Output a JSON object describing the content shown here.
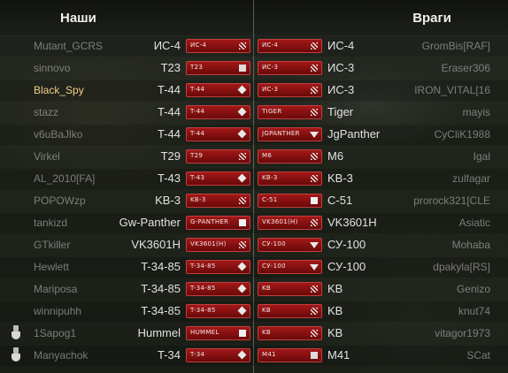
{
  "header": {
    "left_title": "Наши",
    "right_title": "Враги"
  },
  "colors": {
    "badge_red": "#8a1010",
    "highlight_player": "#f0d080"
  },
  "left_team": [
    {
      "player": "Mutant_GCRS",
      "tank": "ИС-4",
      "badge": "ИС-4",
      "icon": "heavy-tank-icon"
    },
    {
      "player": "sinnovo",
      "tank": "T23",
      "badge": "T23",
      "icon": "light-tank-icon"
    },
    {
      "player": "Black_Spy",
      "tank": "T-44",
      "badge": "T-44",
      "icon": "medium-tank-icon",
      "highlight": true
    },
    {
      "player": "stazz",
      "tank": "T-44",
      "badge": "T-44",
      "icon": "medium-tank-icon"
    },
    {
      "player": "v6uBaJlko",
      "tank": "T-44",
      "badge": "T-44",
      "icon": "medium-tank-icon"
    },
    {
      "player": "Virkel",
      "tank": "T29",
      "badge": "T29",
      "icon": "heavy-tank-icon"
    },
    {
      "player": "AL_2010[FA]",
      "tank": "T-43",
      "badge": "T-43",
      "icon": "medium-tank-icon"
    },
    {
      "player": "POPOWzp",
      "tank": "KB-3",
      "badge": "KB-3",
      "icon": "heavy-tank-icon"
    },
    {
      "player": "tankizd",
      "tank": "Gw-Panther",
      "badge": "G-PANTHER",
      "icon": "spg-icon"
    },
    {
      "player": "GTkiller",
      "tank": "VK3601H",
      "badge": "VK3601(H)",
      "icon": "heavy-tank-icon"
    },
    {
      "player": "Hewlett",
      "tank": "T-34-85",
      "badge": "T-34-85",
      "icon": "medium-tank-icon"
    },
    {
      "player": "Mariposa",
      "tank": "T-34-85",
      "badge": "T-34-85",
      "icon": "medium-tank-icon"
    },
    {
      "player": "winnipuhh",
      "tank": "T-34-85",
      "badge": "T-34-85",
      "icon": "medium-tank-icon"
    },
    {
      "player": "1Sapog1",
      "tank": "Hummel",
      "badge": "HUMMEL",
      "icon": "spg-icon",
      "medal": true
    },
    {
      "player": "Manyachok",
      "tank": "T-34",
      "badge": "T-34",
      "icon": "medium-tank-icon",
      "medal": true
    }
  ],
  "right_team": [
    {
      "player": "GromBis[RAF]",
      "tank": "ИС-4",
      "badge": "ИС-4",
      "icon": "heavy-tank-icon"
    },
    {
      "player": "Eraser306",
      "tank": "ИС-3",
      "badge": "ИС-3",
      "icon": "heavy-tank-icon"
    },
    {
      "player": "IRON_VITAL[16",
      "tank": "ИС-3",
      "badge": "ИС-3",
      "icon": "heavy-tank-icon"
    },
    {
      "player": "mayis",
      "tank": "Tiger",
      "badge": "TIGER",
      "icon": "heavy-tank-icon"
    },
    {
      "player": "CyCliK1988",
      "tank": "JgPanther",
      "badge": "JGPANTHER",
      "icon": "td-icon"
    },
    {
      "player": "Igal",
      "tank": "M6",
      "badge": "M6",
      "icon": "heavy-tank-icon"
    },
    {
      "player": "zulfagar",
      "tank": "KB-3",
      "badge": "KB-3",
      "icon": "heavy-tank-icon"
    },
    {
      "player": "prorock321[CLE",
      "tank": "C-51",
      "badge": "C-51",
      "icon": "spg-icon"
    },
    {
      "player": "Asiatic",
      "tank": "VK3601H",
      "badge": "VK3601(H)",
      "icon": "heavy-tank-icon"
    },
    {
      "player": "Mohaba",
      "tank": "СУ-100",
      "badge": "СУ-100",
      "icon": "td-icon"
    },
    {
      "player": "dpakyla[RS]",
      "tank": "СУ-100",
      "badge": "СУ-100",
      "icon": "td-icon"
    },
    {
      "player": "Genizo",
      "tank": "KB",
      "badge": "KB",
      "icon": "heavy-tank-icon"
    },
    {
      "player": "knut74",
      "tank": "KB",
      "badge": "KB",
      "icon": "heavy-tank-icon"
    },
    {
      "player": "vitagor1973",
      "tank": "KB",
      "badge": "KB",
      "icon": "heavy-tank-icon"
    },
    {
      "player": "SCat",
      "tank": "M41",
      "badge": "M41",
      "icon": "light-tank-icon"
    }
  ]
}
